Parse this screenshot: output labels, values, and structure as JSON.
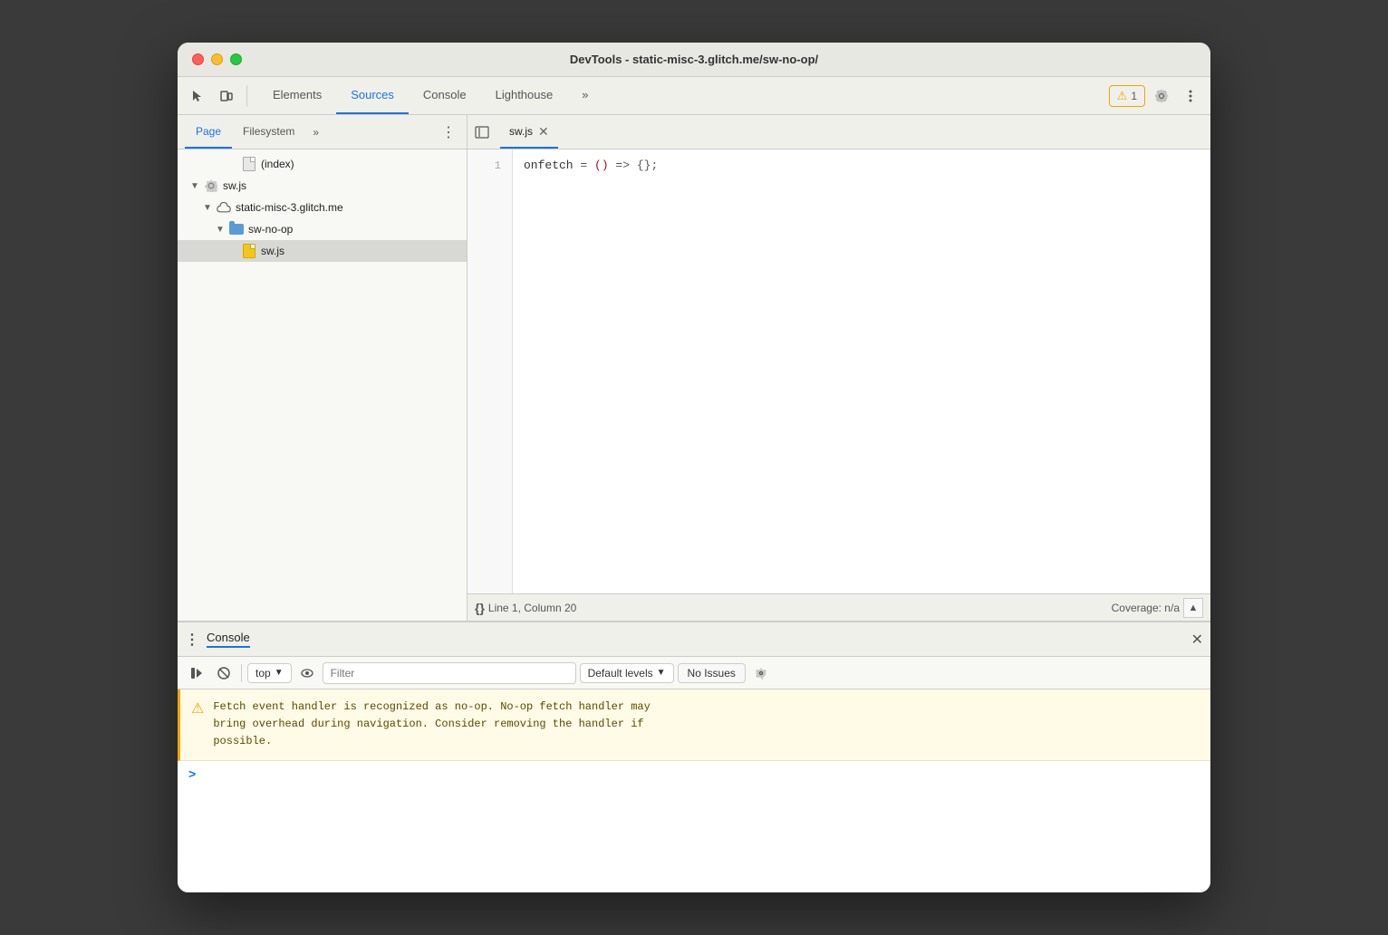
{
  "window": {
    "title": "DevTools - static-misc-3.glitch.me/sw-no-op/"
  },
  "toolbar": {
    "tabs": [
      {
        "id": "elements",
        "label": "Elements",
        "active": false
      },
      {
        "id": "sources",
        "label": "Sources",
        "active": true
      },
      {
        "id": "console",
        "label": "Console",
        "active": false
      },
      {
        "id": "lighthouse",
        "label": "Lighthouse",
        "active": false
      },
      {
        "id": "more",
        "label": "»",
        "active": false
      }
    ],
    "warning_count": "1",
    "settings_label": "Settings",
    "more_label": "More"
  },
  "left_panel": {
    "tabs": [
      {
        "id": "page",
        "label": "Page",
        "active": true
      },
      {
        "id": "filesystem",
        "label": "Filesystem",
        "active": false
      },
      {
        "id": "more",
        "label": "»"
      }
    ],
    "file_tree": [
      {
        "id": "index",
        "indent": 3,
        "label": "(index)",
        "type": "doc",
        "arrow": ""
      },
      {
        "id": "sw_js_root",
        "indent": 1,
        "label": "sw.js",
        "type": "gear",
        "arrow": "▼"
      },
      {
        "id": "domain",
        "indent": 2,
        "label": "static-misc-3.glitch.me",
        "type": "cloud",
        "arrow": "▼"
      },
      {
        "id": "folder",
        "indent": 3,
        "label": "sw-no-op",
        "type": "folder",
        "arrow": "▼"
      },
      {
        "id": "sw_js_file",
        "indent": 4,
        "label": "sw.js",
        "type": "js",
        "arrow": "",
        "selected": true
      }
    ]
  },
  "editor": {
    "open_file": "sw.js",
    "tab_label": "sw.js",
    "code_lines": [
      {
        "num": "1",
        "code": "onfetch = () => {};"
      }
    ],
    "status": {
      "line": "Line 1, Column 20",
      "coverage": "Coverage: n/a",
      "format_label": "{}"
    }
  },
  "console_panel": {
    "title": "Console",
    "toolbar": {
      "context": "top",
      "filter_placeholder": "Filter",
      "levels_label": "Default levels",
      "issues_label": "No Issues"
    },
    "messages": [
      {
        "type": "warning",
        "text": "Fetch event handler is recognized as no-op. No-op fetch handler may\nbring overhead during navigation. Consider removing the handler if\npossible."
      }
    ],
    "prompt_symbol": ">"
  }
}
